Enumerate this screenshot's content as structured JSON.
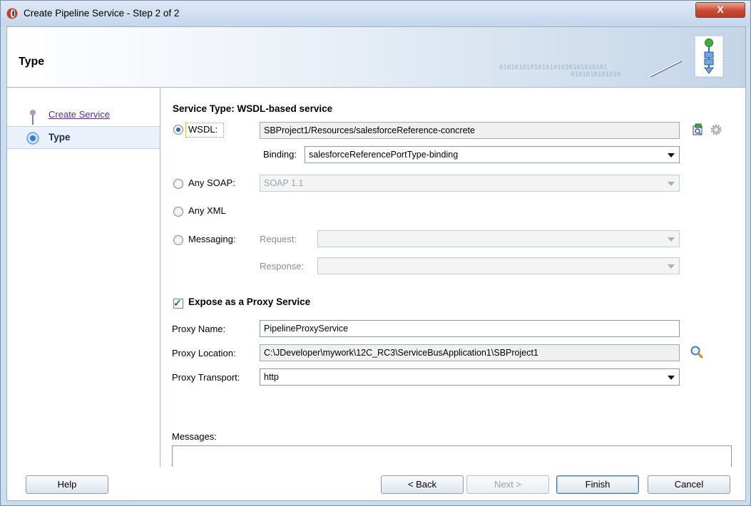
{
  "window": {
    "title": "Create Pipeline Service - Step 2 of 2",
    "close_label": "X"
  },
  "header": {
    "title": "Type",
    "binary_line1": "0101010101010101010101010101",
    "binary_line2": "0101010101010"
  },
  "nav": {
    "items": [
      {
        "label": "Create Service"
      },
      {
        "label": "Type"
      }
    ]
  },
  "main": {
    "section_title": "Service Type: WSDL-based service",
    "wsdl": {
      "label": "WSDL:",
      "value": "SBProject1/Resources/salesforceReference-concrete",
      "selected": true
    },
    "binding": {
      "label": "Binding:",
      "value": "salesforceReferencePortType-binding"
    },
    "any_soap": {
      "label": "Any SOAP:",
      "value": "SOAP 1.1"
    },
    "any_xml": {
      "label": "Any XML"
    },
    "messaging": {
      "label": "Messaging:",
      "request_label": "Request:",
      "response_label": "Response:",
      "request_value": "",
      "response_value": ""
    },
    "expose_proxy": {
      "label": "Expose as a Proxy Service",
      "checked": true
    },
    "proxy_name": {
      "label": "Proxy Name:",
      "value": "PipelineProxyService"
    },
    "proxy_location": {
      "label": "Proxy Location:",
      "value": "C:\\JDeveloper\\mywork\\12C_RC3\\ServiceBusApplication1\\SBProject1"
    },
    "proxy_transport": {
      "label": "Proxy Transport:",
      "value": "http"
    },
    "messages": {
      "label": "Messages:",
      "value": ""
    }
  },
  "footer": {
    "help": "Help",
    "back": "< Back",
    "next": "Next >",
    "finish": "Finish",
    "cancel": "Cancel"
  },
  "icons": {
    "app": "oracle-jdev-icon",
    "browse_wsdl": "browse-wsdl-icon",
    "settings": "gear-icon",
    "search": "search-icon"
  },
  "colors": {
    "accent": "#2a6ab0",
    "link": "#5a2a88",
    "close": "#c94a33"
  }
}
